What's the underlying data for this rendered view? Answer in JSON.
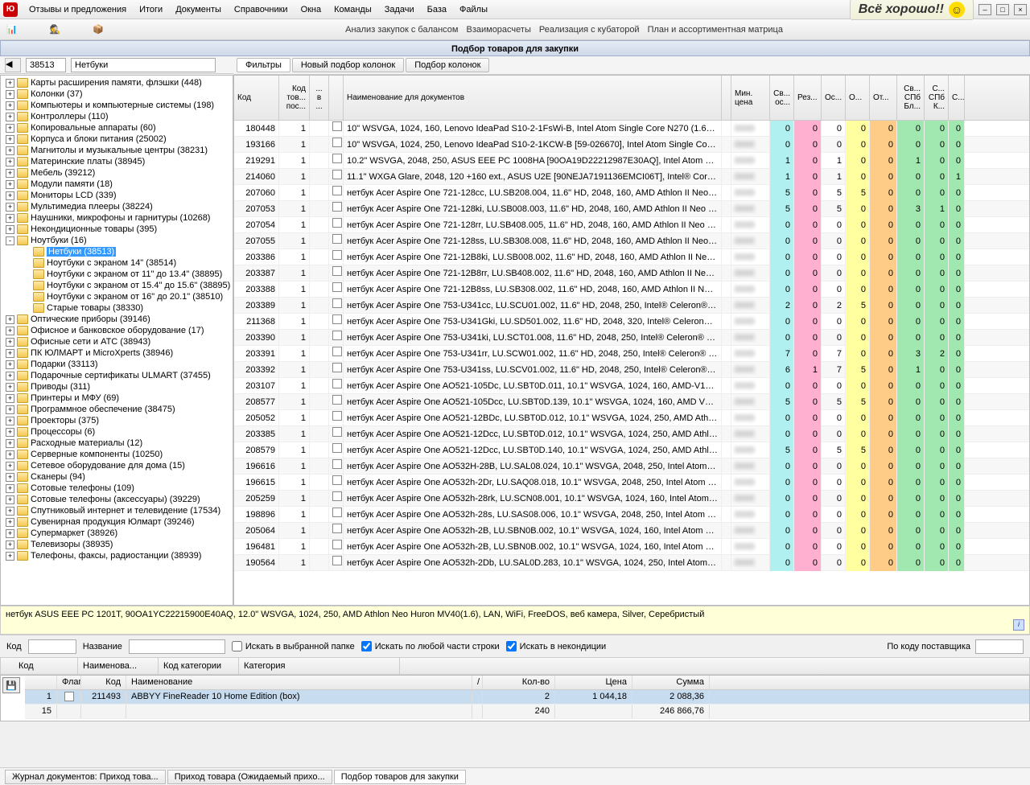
{
  "menu": [
    "Отзывы и предложения",
    "Итоги",
    "Документы",
    "Справочники",
    "Окна",
    "Команды",
    "Задачи",
    "База",
    "Файлы"
  ],
  "banner": "Всё хорошо!!",
  "toolbar_links": [
    "Анализ закупок с балансом",
    "Взаиморасчеты",
    "Реализация с кубаторой",
    "План и ассортиментная матрица"
  ],
  "window_title": "Подбор товаров для закупки",
  "code_input": "38513",
  "name_input": "Нетбуки",
  "filter_tabs": [
    "Фильтры",
    "Новый подбор колонок",
    "Подбор колонок"
  ],
  "tree": [
    {
      "l": "Карты расширения памяти, флэшки (448)"
    },
    {
      "l": "Колонки (37)"
    },
    {
      "l": "Компьютеры и компьютерные системы (198)"
    },
    {
      "l": "Контроллеры (110)"
    },
    {
      "l": "Копировальные аппараты (60)"
    },
    {
      "l": "Корпуса и блоки питания (25002)"
    },
    {
      "l": "Магнитолы и музыкальные центры (38231)"
    },
    {
      "l": "Материнские платы (38945)"
    },
    {
      "l": "Мебель (39212)"
    },
    {
      "l": "Модули памяти (18)"
    },
    {
      "l": "Мониторы LCD (339)"
    },
    {
      "l": "Мультимедиа плееры (38224)"
    },
    {
      "l": "Наушники, микрофоны и гарнитуры  (10268)"
    },
    {
      "l": "Некондиционные товары (395)"
    },
    {
      "l": "Ноутбуки (16)",
      "exp": "-"
    },
    {
      "l": "Нетбуки (38513)",
      "child": true,
      "sel": true
    },
    {
      "l": "Ноутбуки с экраном 14\" (38514)",
      "child": true
    },
    {
      "l": "Ноутбуки с экраном от 11\" до 13.4\" (38895)",
      "child": true
    },
    {
      "l": "Ноутбуки с экраном от 15.4\" до 15.6\" (38895)",
      "child": true
    },
    {
      "l": "Ноутбуки с экраном от 16\" до 20.1\" (38510)",
      "child": true
    },
    {
      "l": "Старые товары (38330)",
      "child": true
    },
    {
      "l": "Оптические приборы (39146)"
    },
    {
      "l": "Офисное и банковское оборудование (17)"
    },
    {
      "l": "Офисные сети и АТС (38943)"
    },
    {
      "l": "ПК ЮЛМАРТ и MicroXperts (38946)"
    },
    {
      "l": "Подарки (33113)"
    },
    {
      "l": "Подарочные сертификаты ULMART (37455)"
    },
    {
      "l": "Приводы (311)"
    },
    {
      "l": "Принтеры и МФУ (69)"
    },
    {
      "l": "Программное обеспечение (38475)"
    },
    {
      "l": "Проекторы (375)"
    },
    {
      "l": "Процессоры (6)"
    },
    {
      "l": "Расходные материалы (12)"
    },
    {
      "l": "Серверные компоненты (10250)"
    },
    {
      "l": "Сетевое оборудование для дома (15)"
    },
    {
      "l": "Сканеры (94)"
    },
    {
      "l": "Сотовые телефоны (109)"
    },
    {
      "l": "Сотовые телефоны (аксессуары) (39229)"
    },
    {
      "l": "Спутниковый интернет и телевидение (17534)"
    },
    {
      "l": "Сувенирная продукция Юлмарт (39246)"
    },
    {
      "l": "Супермаркет (38926)"
    },
    {
      "l": "Телевизоры (38935)"
    },
    {
      "l": "Телефоны, факсы, радиостанции (38939)"
    }
  ],
  "grid_cols": [
    "Код",
    "Код тов... пос...",
    "... в ...",
    "",
    "Наименование для документов",
    "",
    "Мин. цена",
    "Св... ос...",
    "Рез...",
    "Ос...",
    "О...",
    "От...",
    "Св... СПб Бл...",
    "С... СПб К...",
    "С..."
  ],
  "rows": [
    {
      "c": "180448",
      "k": "1",
      "n": "10\" WSVGA, 1024, 160, Lenovo IdeaPad S10-2-1FsWi-B, Intel Atom Single Core N270 (1.60GHz) FSB...",
      "sv": 0,
      "rz": 0,
      "os": 0,
      "o": 0,
      "ot": 0,
      "s1": 0,
      "s2": 0,
      "s3": 0
    },
    {
      "c": "193166",
      "k": "1",
      "n": "10\" WSVGA, 1024, 250, Lenovo IdeaPad S10-2-1KCW-B [59-026670], Intel Atom Single Core N270 (...",
      "sv": 0,
      "rz": 0,
      "os": 0,
      "o": 0,
      "ot": 0,
      "s1": 0,
      "s2": 0,
      "s3": 0
    },
    {
      "c": "219291",
      "k": "1",
      "n": "10.2\" WSVGA, 2048, 250, ASUS EEE PC 1008HA [90OA19D22212987E30AQ], Intel Atom Single Core...",
      "sv": 1,
      "rz": 0,
      "os": 1,
      "o": 0,
      "ot": 0,
      "s1": 1,
      "s2": 0,
      "s3": 0
    },
    {
      "c": "214060",
      "k": "1",
      "n": "11.1\" WXGA Glare, 2048, 120 +160 ext., ASUS U2E [90NEJA7191136EMCI06T], Intel® Core™2 Du...",
      "sv": 1,
      "rz": 0,
      "os": 1,
      "o": 0,
      "ot": 0,
      "s1": 0,
      "s2": 0,
      "s3": 1
    },
    {
      "c": "207060",
      "k": "1",
      "n": "нетбук Acer Aspire One 721-128cc, LU.SB208.004, 11.6\" HD, 2048, 160, AMD Athlon II Neo K125, ...",
      "sv": 5,
      "rz": 0,
      "os": 5,
      "o": 5,
      "ot": 0,
      "s1": 0,
      "s2": 0,
      "s3": 0
    },
    {
      "c": "207053",
      "k": "1",
      "n": "нетбук Acer Aspire One 721-128ki, LU.SB008.003, 11.6\" HD, 2048, 160, AMD Athlon II Neo K125, A...",
      "sv": 5,
      "rz": 0,
      "os": 5,
      "o": 0,
      "ot": 0,
      "s1": 3,
      "s2": 1,
      "s3": 0
    },
    {
      "c": "207054",
      "k": "1",
      "n": "нетбук Acer Aspire One 721-128rr, LU.SB408.005, 11.6\" HD, 2048, 160, AMD Athlon II Neo K125, ...",
      "sv": 0,
      "rz": 0,
      "os": 0,
      "o": 0,
      "ot": 0,
      "s1": 0,
      "s2": 0,
      "s3": 0
    },
    {
      "c": "207055",
      "k": "1",
      "n": "нетбук Acer Aspire One 721-128ss, LU.SB308.008, 11.6\" HD, 2048, 160, AMD Athlon II Neo K125, ...",
      "sv": 0,
      "rz": 0,
      "os": 0,
      "o": 0,
      "ot": 0,
      "s1": 0,
      "s2": 0,
      "s3": 0
    },
    {
      "c": "203386",
      "k": "1",
      "n": "нетбук Acer Aspire One 721-12B8ki, LU.SB008.002, 11.6\" HD, 2048, 160, AMD Athlon II Neo K125,...",
      "sv": 0,
      "rz": 0,
      "os": 0,
      "o": 0,
      "ot": 0,
      "s1": 0,
      "s2": 0,
      "s3": 0
    },
    {
      "c": "203387",
      "k": "1",
      "n": "нетбук Acer Aspire One 721-12B8rr, LU.SB408.002, 11.6\" HD, 2048, 160, AMD Athlon II Neo K125,...",
      "sv": 0,
      "rz": 0,
      "os": 0,
      "o": 0,
      "ot": 0,
      "s1": 0,
      "s2": 0,
      "s3": 0
    },
    {
      "c": "203388",
      "k": "1",
      "n": "нетбук Acer Aspire One 721-12B8ss, LU.SB308.002, 11.6\" HD, 2048, 160, AMD Athlon II Neo K125,...",
      "sv": 0,
      "rz": 0,
      "os": 0,
      "o": 0,
      "ot": 0,
      "s1": 0,
      "s2": 0,
      "s3": 0
    },
    {
      "c": "203389",
      "k": "1",
      "n": "нетбук Acer Aspire One 753-U341cc, LU.SCU01.002, 11.6\" HD, 2048, 250, Intel® Celeron® SU340...",
      "sv": 2,
      "rz": 0,
      "os": 2,
      "o": 5,
      "ot": 0,
      "s1": 0,
      "s2": 0,
      "s3": 0
    },
    {
      "c": "211368",
      "k": "1",
      "n": "нетбук Acer Aspire One 753-U341Gki, LU.SD501.002, 11.6\" HD, 2048, 320, Intel® Celeron® SU34...",
      "sv": 0,
      "rz": 0,
      "os": 0,
      "o": 0,
      "ot": 0,
      "s1": 0,
      "s2": 0,
      "s3": 0
    },
    {
      "c": "203390",
      "k": "1",
      "n": "нетбук Acer Aspire One 753-U341ki, LU.SCT01.008, 11.6\" HD, 2048, 250, Intel® Celeron® SU3400...",
      "sv": 0,
      "rz": 0,
      "os": 0,
      "o": 0,
      "ot": 0,
      "s1": 0,
      "s2": 0,
      "s3": 0
    },
    {
      "c": "203391",
      "k": "1",
      "n": "нетбук Acer Aspire One 753-U341rr, LU.SCW01.002, 11.6\" HD, 2048, 250, Intel® Celeron® SU340...",
      "sv": 7,
      "rz": 0,
      "os": 7,
      "o": 0,
      "ot": 0,
      "s1": 3,
      "s2": 2,
      "s3": 0
    },
    {
      "c": "203392",
      "k": "1",
      "n": "нетбук Acer Aspire One 753-U341ss, LU.SCV01.002, 11.6\" HD, 2048, 250, Intel® Celeron® SU3400...",
      "sv": 6,
      "rz": 1,
      "os": 7,
      "o": 5,
      "ot": 0,
      "s1": 1,
      "s2": 0,
      "s3": 0
    },
    {
      "c": "203107",
      "k": "1",
      "n": "нетбук Acer Aspire One AO521-105Dc, LU.SBT0D.011, 10.1\" WSVGA, 1024, 160, AMD-V105 (1.2GH...",
      "sv": 0,
      "rz": 0,
      "os": 0,
      "o": 0,
      "ot": 0,
      "s1": 0,
      "s2": 0,
      "s3": 0
    },
    {
      "c": "208577",
      "k": "1",
      "n": "нетбук Acer Aspire One AO521-105Dcc, LU.SBT0D.139, 10.1\" WSVGA, 1024, 160, AMD V105(1.2G...",
      "sv": 5,
      "rz": 0,
      "os": 5,
      "o": 5,
      "ot": 0,
      "s1": 0,
      "s2": 0,
      "s3": 0
    },
    {
      "c": "205052",
      "k": "1",
      "n": "нетбук Acer Aspire One AO521-12BDc, LU.SBT0D.012, 10.1\" WSVGA, 1024, 250, AMD Athlon™ II N...",
      "sv": 0,
      "rz": 0,
      "os": 0,
      "o": 0,
      "ot": 0,
      "s1": 0,
      "s2": 0,
      "s3": 0
    },
    {
      "c": "203385",
      "k": "1",
      "n": "нетбук Acer Aspire One AO521-12Dcc, LU.SBT0D.012, 10.1\" WSVGA, 1024, 250, AMD Athlon™ II N...",
      "sv": 0,
      "rz": 0,
      "os": 0,
      "o": 0,
      "ot": 0,
      "s1": 0,
      "s2": 0,
      "s3": 0
    },
    {
      "c": "208579",
      "k": "1",
      "n": "нетбук Acer Aspire One AO521-12Dcc, LU.SBT0D.140, 10.1\" WSVGA, 1024, 250, AMD Athlon™ II N...",
      "sv": 5,
      "rz": 0,
      "os": 5,
      "o": 5,
      "ot": 0,
      "s1": 0,
      "s2": 0,
      "s3": 0
    },
    {
      "c": "196616",
      "k": "1",
      "n": "нетбук Acer Aspire One AO532H-28B, LU.SAL08.024, 10.1\" WSVGA, 2048, 250, Intel Atom Single C...",
      "sv": 0,
      "rz": 0,
      "os": 0,
      "o": 0,
      "ot": 0,
      "s1": 0,
      "s2": 0,
      "s3": 0
    },
    {
      "c": "196615",
      "k": "1",
      "n": "нетбук Acer Aspire One AO532h-2Dr, LU.SAQ08.018, 10.1\" WSVGA, 2048, 250, Intel Atom Single C...",
      "sv": 0,
      "rz": 0,
      "os": 0,
      "o": 0,
      "ot": 0,
      "s1": 0,
      "s2": 0,
      "s3": 0
    },
    {
      "c": "205259",
      "k": "1",
      "n": "нетбук Acer Aspire One AO532h-28rk, LU.SCN08.001, 10.1\" WSVGA, 1024, 160, Intel Atom Single ...",
      "sv": 0,
      "rz": 0,
      "os": 0,
      "o": 0,
      "ot": 0,
      "s1": 0,
      "s2": 0,
      "s3": 0
    },
    {
      "c": "198896",
      "k": "1",
      "n": "нетбук Acer Aspire One AO532h-28s, LU.SAS08.006, 10.1\" WSVGA, 2048, 250, Intel Atom Single ...",
      "sv": 0,
      "rz": 0,
      "os": 0,
      "o": 0,
      "ot": 0,
      "s1": 0,
      "s2": 0,
      "s3": 0
    },
    {
      "c": "205064",
      "k": "1",
      "n": "нетбук Acer Aspire One AO532h-2B, LU.SBN0B.002, 10.1\" WSVGA, 1024, 160, Intel Atom Single Co...",
      "sv": 0,
      "rz": 0,
      "os": 0,
      "o": 0,
      "ot": 0,
      "s1": 0,
      "s2": 0,
      "s3": 0
    },
    {
      "c": "196481",
      "k": "1",
      "n": "нетбук Acer Aspire One AO532h-2B, LU.SBN0B.002, 10.1\" WSVGA, 1024, 160, Intel Atom Single Co...",
      "sv": 0,
      "rz": 0,
      "os": 0,
      "o": 0,
      "ot": 0,
      "s1": 0,
      "s2": 0,
      "s3": 0
    },
    {
      "c": "190564",
      "k": "1",
      "n": "нетбук Acer Aspire One AO532h-2Db, LU.SAL0D.283, 10.1\" WSVGA, 1024, 250, Intel Atom Single C...",
      "sv": 0,
      "rz": 0,
      "os": 0,
      "o": 0,
      "ot": 0,
      "s1": 0,
      "s2": 0,
      "s3": 0
    }
  ],
  "desc": "нетбук ASUS EEE PC 1201T, 90OA1YC22215900E40AQ, 12.0\" WSVGA, 1024, 250, AMD Athlon Neo Huron MV40(1.6), LAN, WiFi, FreeDOS, веб камера, Silver, Серебристый",
  "search": {
    "code_label": "Код",
    "name_label": "Название",
    "chk1": "Искать в выбранной папке",
    "chk2": "Искать по любой части строки",
    "chk3": "Искать в некондиции",
    "right_label": "По коду поставщика"
  },
  "bottom_cols": [
    "Код",
    "Наименова...",
    "Код категории",
    "Категория"
  ],
  "cart_cols": [
    "",
    "Флаг",
    "Код",
    "Наименование",
    "/",
    "Кол-во",
    "Цена",
    "Сумма"
  ],
  "cart_rows": [
    {
      "n": "1",
      "code": "211493",
      "name": "ABBYY FineReader 10 Home Edition (box)",
      "qty": "2",
      "price": "1 044,18",
      "sum": "2 088,36",
      "sel": true
    }
  ],
  "cart_totals": {
    "n": "15",
    "qty": "240",
    "sum": "246 866,76"
  },
  "status_tabs": [
    "Журнал документов: Приход това...",
    "Приход товара (Ожидаемый прихо...",
    "Подбор товаров для закупки"
  ]
}
